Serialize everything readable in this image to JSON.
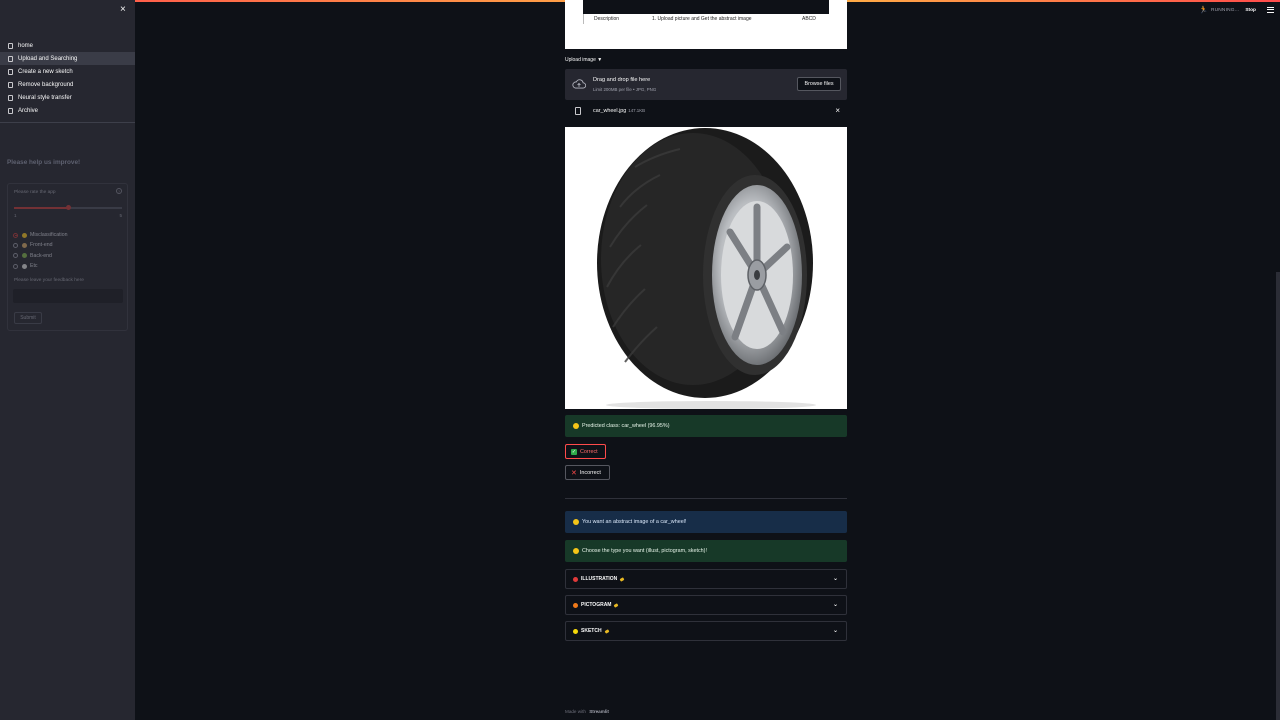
{
  "sidebar": {
    "close_label": "×",
    "nav": [
      {
        "label": "home",
        "active": false
      },
      {
        "label": "Upload and Searching",
        "active": true
      },
      {
        "label": "Create a new sketch",
        "active": false
      },
      {
        "label": "Remove background",
        "active": false
      },
      {
        "label": "Neural style transfer",
        "active": false
      },
      {
        "label": "Archive",
        "active": false
      }
    ],
    "help_title": "Please help us improve!",
    "feedback": {
      "rate_label": "Please rate the app",
      "help_icon": "?",
      "slider_min": "1",
      "slider_max": "5",
      "slider_value": 3,
      "options": [
        "Misclassification",
        "Front-end",
        "Back-end",
        "Etc"
      ],
      "option_colors": [
        "#e8b923",
        "#c9a063",
        "#7aa84a",
        "#d0d0d0"
      ],
      "selected_option": "Misclassification",
      "text_label": "Please leave your feedback here",
      "submit_label": "Submit"
    }
  },
  "header": {
    "status": "RUNNING...",
    "stop_label": "Stop",
    "menu_icon": "hamburger-icon"
  },
  "top_table": {
    "col1": "Description",
    "col2": "1. Upload picture and Get the abstract image",
    "col3": "ABCD"
  },
  "uploader": {
    "label": "Upload image ▼",
    "drop_text": "Drag and drop file here",
    "limit_text": "Limit 200MB per file • JPG, PNG",
    "browse_label": "Browse files",
    "file_name": "car_wheel.jpg",
    "file_size": "147.1KB",
    "remove_label": "×"
  },
  "prediction": {
    "text": "Predicted class: car_wheel (96.95%)"
  },
  "buttons": {
    "correct": "Correct",
    "incorrect": "Incorrect"
  },
  "messages": {
    "want": "You want an abstract image of a car_wheel!",
    "choose": "Choose the type you want (illust, pictogram, sketch)!"
  },
  "expanders": [
    {
      "label": "ILLUSTRATION",
      "color": "#e03a3a"
    },
    {
      "label": "PICTOGRAM",
      "color": "#f07a1a"
    },
    {
      "label": "SKETCH",
      "color": "#f5d90a"
    }
  ],
  "footer": {
    "prefix": "Made with",
    "brand": "Streamlit"
  },
  "colors": {
    "background": "#0e1117",
    "sidebar": "#262730",
    "accent": "#ff4b4b",
    "success_bg": "#173928",
    "info_bg": "#172d48"
  }
}
